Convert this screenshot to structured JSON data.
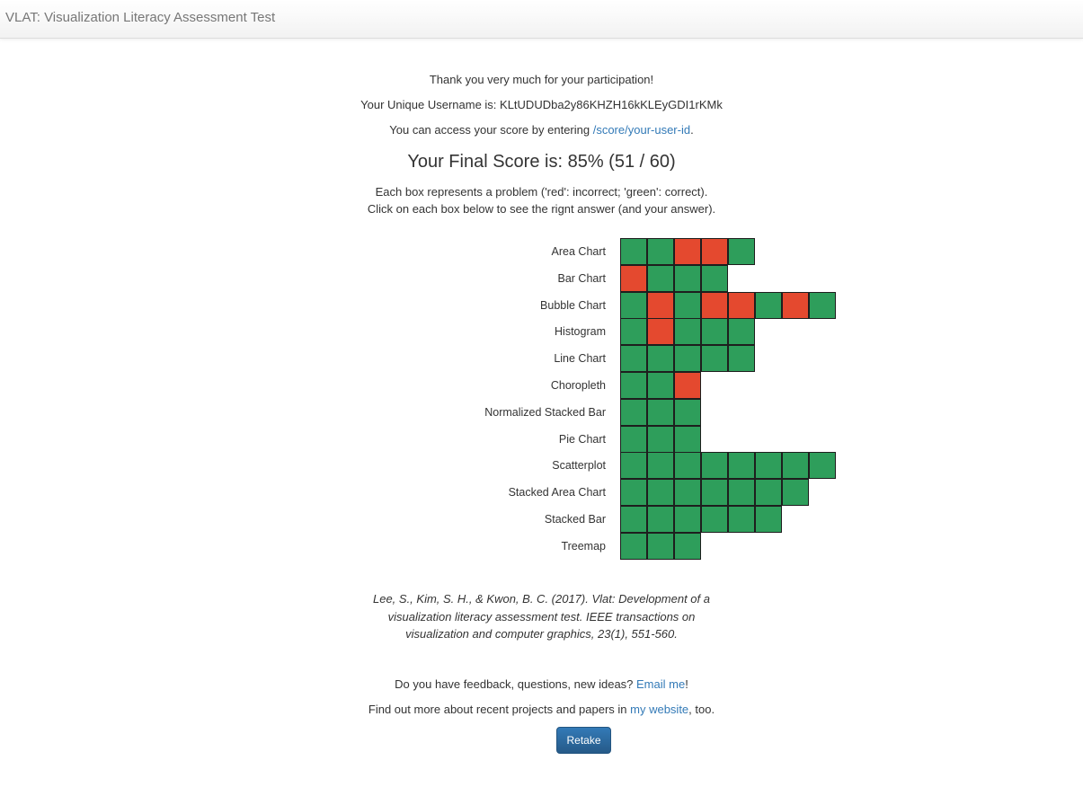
{
  "navbar": {
    "title": "VLAT: Visualization Literacy Assessment Test"
  },
  "thanks": "Thank you very much for your participation!",
  "username": {
    "prefix": "Your Unique Username is: ",
    "value": "KLtUDUDba2y86KHZH16kKLEyGDI1rKMk"
  },
  "access": {
    "prefix": "You can access your score by entering ",
    "link": "/score/your-user-id",
    "suffix": "."
  },
  "score": {
    "text": "Your Final Score is: 85% (51 / 60)",
    "percent": 85,
    "correct": 51,
    "total": 60
  },
  "instructions": {
    "line1": "Each box represents a problem ('red': incorrect; 'green': correct).",
    "line2": "Click on each box below to see the rignt answer (and your answer)."
  },
  "colors": {
    "correct": "#2e9e5b",
    "incorrect": "#e4492f",
    "link": "#337ab7",
    "button": "#2d6ca2"
  },
  "grid": {
    "rows": [
      {
        "label": "Area Chart",
        "results": [
          1,
          1,
          0,
          0,
          1
        ]
      },
      {
        "label": "Bar Chart",
        "results": [
          0,
          1,
          1,
          1
        ]
      },
      {
        "label": "Bubble Chart",
        "results": [
          1,
          0,
          1,
          0,
          0,
          1,
          0,
          1
        ]
      },
      {
        "label": "Histogram",
        "results": [
          1,
          0,
          1,
          1,
          1
        ]
      },
      {
        "label": "Line Chart",
        "results": [
          1,
          1,
          1,
          1,
          1
        ]
      },
      {
        "label": "Choropleth",
        "results": [
          1,
          1,
          0
        ]
      },
      {
        "label": "Normalized Stacked Bar",
        "results": [
          1,
          1,
          1
        ]
      },
      {
        "label": "Pie Chart",
        "results": [
          1,
          1,
          1
        ]
      },
      {
        "label": "Scatterplot",
        "results": [
          1,
          1,
          1,
          1,
          1,
          1,
          1,
          1
        ]
      },
      {
        "label": "Stacked Area Chart",
        "results": [
          1,
          1,
          1,
          1,
          1,
          1,
          1
        ]
      },
      {
        "label": "Stacked Bar",
        "results": [
          1,
          1,
          1,
          1,
          1,
          1
        ]
      },
      {
        "label": "Treemap",
        "results": [
          1,
          1,
          1
        ]
      }
    ]
  },
  "citation": {
    "line1": "Lee, S., Kim, S. H., & Kwon, B. C. (2017). Vlat: Development of a",
    "line2": "visualization literacy assessment test. IEEE transactions on",
    "line3": "visualization and computer graphics, 23(1), 551-560."
  },
  "feedback": {
    "prefix": "Do you have feedback, questions, new ideas? ",
    "link": "Email me",
    "suffix": "!"
  },
  "website": {
    "prefix": "Find out more about recent projects and papers in ",
    "link": "my website",
    "suffix": ", too."
  },
  "retake_label": "Retake"
}
